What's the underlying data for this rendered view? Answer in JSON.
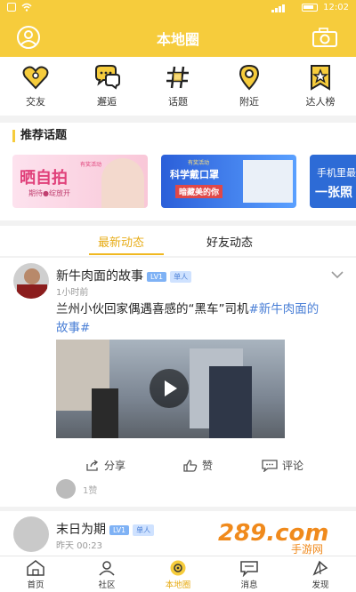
{
  "status": {
    "battery_pct": 80,
    "time": "12:02"
  },
  "header": {
    "title": "本地圈"
  },
  "quick_menu": [
    {
      "label": "交友",
      "icon": "heart-location-icon"
    },
    {
      "label": "邂逅",
      "icon": "chat-bubbles-icon"
    },
    {
      "label": "话题",
      "icon": "hash-icon"
    },
    {
      "label": "附近",
      "icon": "location-pin-icon"
    },
    {
      "label": "达人榜",
      "icon": "star-badge-icon"
    }
  ],
  "topics": {
    "title": "推荐话题",
    "banners": [
      {
        "text": "晒自拍",
        "sub": "期待●绽放开",
        "tag": "有奖活动"
      },
      {
        "text": "科学戴口罩",
        "sub": "暗藏美的你",
        "tag": "有奖活动"
      },
      {
        "text": "手机里最",
        "sub": "一张照"
      }
    ]
  },
  "feed_tabs": [
    {
      "label": "最新动态"
    },
    {
      "label": "好友动态"
    }
  ],
  "post1": {
    "author": "新牛肉面的故事",
    "level": "LV1",
    "role": "单人",
    "time": "1小时前",
    "text": "兰州小伙回家偶遇喜感的“黑车”司机",
    "hashtag": "#新牛肉面的故事#",
    "actions": {
      "share": "分享",
      "like": "赞",
      "comment": "评论"
    },
    "likes_text": "1赞"
  },
  "post2": {
    "author": "末日为期",
    "level": "LV1",
    "role": "单人",
    "time": "昨天 00:23"
  },
  "watermark": {
    "text": "289.com",
    "sub": "手游网"
  },
  "nav": [
    {
      "label": "首页",
      "icon": "home-icon"
    },
    {
      "label": "社区",
      "icon": "community-icon"
    },
    {
      "label": "本地圈",
      "icon": "local-circle-icon"
    },
    {
      "label": "消息",
      "icon": "message-icon"
    },
    {
      "label": "发现",
      "icon": "discover-icon"
    }
  ],
  "colors": {
    "accent": "#f6cc3c",
    "active_text": "#e7ad1a",
    "hashtag": "#4a7fd6"
  }
}
